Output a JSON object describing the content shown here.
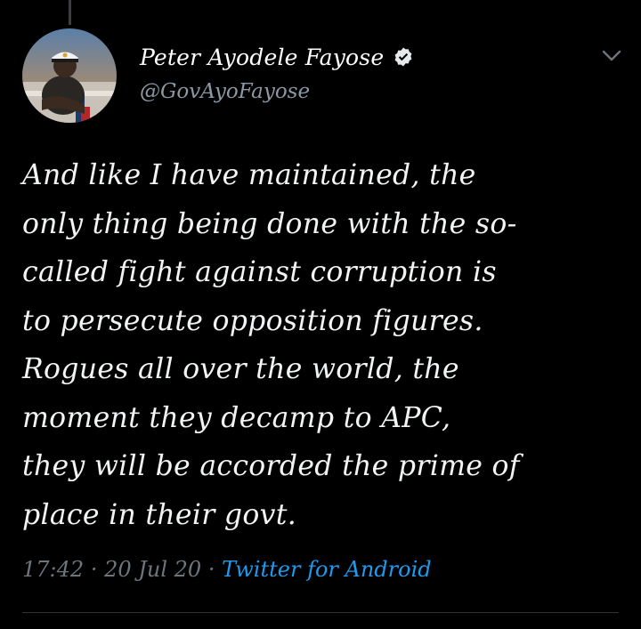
{
  "user": {
    "display_name": "Peter Ayodele Fayose",
    "handle": "@GovAyoFayose",
    "verified": true
  },
  "tweet": {
    "text": "And like I have maintained,  the\nonly thing being done with the so-\ncalled fight against corruption is\nto persecute opposition figures.\nRogues all over the world,  the\nmoment they decamp to APC,\nthey will be accorded the prime of\nplace in their govt."
  },
  "meta": {
    "time": "17:42",
    "separator": "·",
    "date": "20 Jul 20",
    "source": "Twitter for Android"
  },
  "icons": {
    "verified": "verified-badge-icon",
    "menu": "chevron-down-icon"
  },
  "colors": {
    "background": "#000000",
    "text": "#f1f3f4",
    "muted": "#6e767d",
    "accent": "#1d9bf0"
  }
}
